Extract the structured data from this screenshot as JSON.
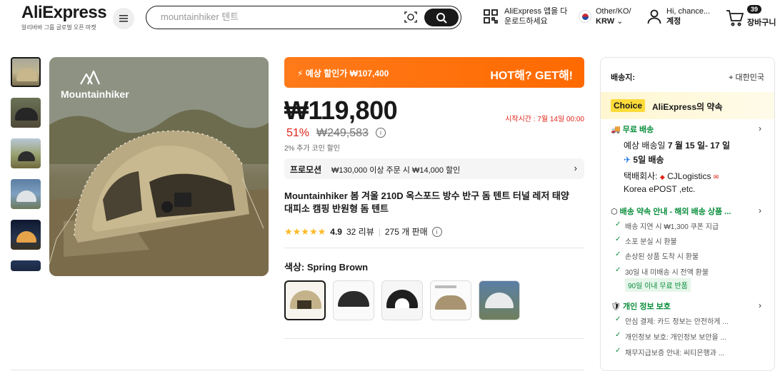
{
  "header": {
    "logo": "AliExpress",
    "logo_sub": "알리바바 그룹 글로벌 오픈 마켓",
    "search_placeholder": "mountainhiker 텐트",
    "app_line1": "AliExpress 앱을 다",
    "app_line2": "운로드하세요",
    "region_line1": "Other/KO/",
    "region_line2": "KRW",
    "account_line1": "Hi, chance...",
    "account_line2": "계정",
    "cart_count": "39",
    "cart_label": "장바구니"
  },
  "gallery": {
    "brand_watermark": "Mountainhiker"
  },
  "product": {
    "banner_left": "예상 할인가 ₩107,400",
    "banner_right": "HOT해? GET해!",
    "price": "₩119,800",
    "start_time": "시작시간 : 7월 14일 00:00",
    "discount": "51%",
    "original_price": "₩249,583",
    "coin_text": "2% 추가 코인 할인",
    "promo_label": "프로모션",
    "promo_text": "₩130,000 이상 주문 시 ₩14,000 할인",
    "title_line1": "Mountainhiker 봄 겨울 210D 옥스포드 방수 반구 돔 텐트 터널 레저 태양",
    "title_line2": "대피소 캠핑 반원형 돔 텐트",
    "rating": "4.9",
    "reviews": "32 리뷰",
    "sold": "275 개 판매",
    "color_label": "색상: Spring Brown"
  },
  "shipping": {
    "ship_to_label": "배송지:",
    "ship_to_value": "대한민국",
    "choice_badge": "Choice",
    "choice_text": "AliExpress의 약속",
    "free_shipping": "무료 배송",
    "est_prefix": "예상 배송일 ",
    "est_dates": "7 월 15 일- 17 일",
    "fast_label": "5일 배송",
    "carrier_prefix": "택배회사: ",
    "carrier_cj": "CJLogistics",
    "carrier_epost": "Korea ePOST ,etc.",
    "promise_title": "배송 약속 안내 - 해외 배송 상품 ...",
    "promise_items": [
      "배송 지연 시 ₩1,300 쿠폰 지급",
      "소포 분실 시 환불",
      "손상된 상품 도착 시 환불",
      "30일 내 미배송 시 전액 환불"
    ],
    "return_tag": "90일 이내 무료 반품",
    "privacy_title": "개인 정보 보호",
    "privacy_items": [
      "안심 결제: 카드 정보는 안전하게 ...",
      "개인정보 보호: 개인정보 보안을 ...",
      "채무지급보증 안내: 씨티은행과 ..."
    ]
  },
  "colors": {
    "accent_orange": "#ff6a00",
    "price_red": "#e1251b",
    "green": "#0a8e3c",
    "choice_yellow": "#fddb3a"
  }
}
